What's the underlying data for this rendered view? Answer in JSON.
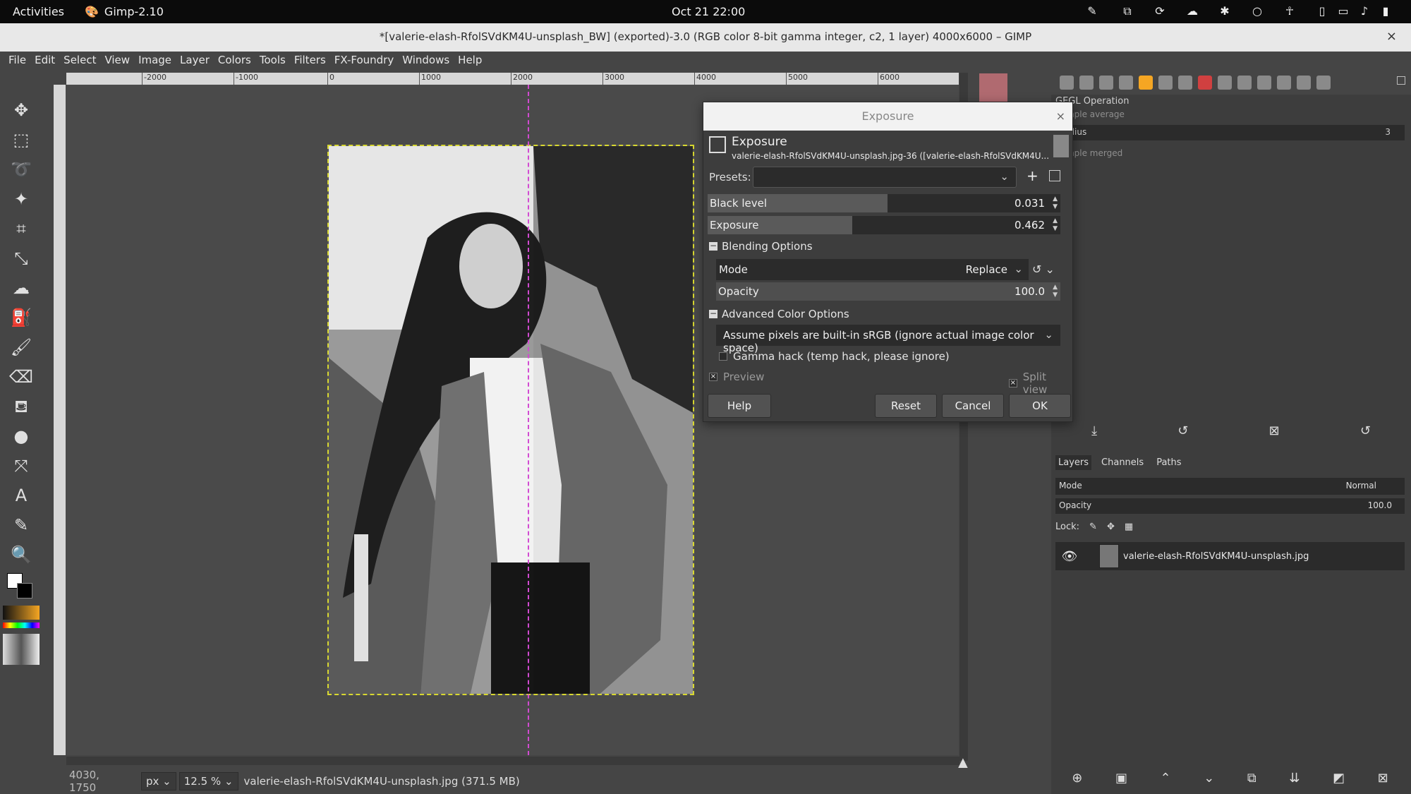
{
  "topbar": {
    "activities": "Activities",
    "app": "Gimp-2.10",
    "clock": "Oct 21  22:00"
  },
  "window": {
    "title": "*[valerie-elash-RfolSVdKM4U-unsplash_BW] (exported)-3.0 (RGB color 8-bit gamma integer, c2, 1 layer) 4000x6000 – GIMP",
    "close": "×"
  },
  "menu": [
    "File",
    "Edit",
    "Select",
    "View",
    "Image",
    "Layer",
    "Colors",
    "Tools",
    "Filters",
    "FX-Foundry",
    "Windows",
    "Help"
  ],
  "ruler_labels": [
    "-2000",
    "-1000",
    "0",
    "1000",
    "2000",
    "3000",
    "4000",
    "5000",
    "6000"
  ],
  "status": {
    "coords": "4030, 1750",
    "unit": "px",
    "zoom": "12.5 %",
    "file": "valerie-elash-RfolSVdKM4U-unsplash.jpg (371.5 MB)"
  },
  "gegl": {
    "title": "GEGL Operation",
    "sample_average": "Sample average",
    "radius_label": "Radius",
    "radius_value": "3",
    "sample_merged": "Sample merged"
  },
  "dialog": {
    "window_title": "Exposure",
    "close": "×",
    "name": "Exposure",
    "subtitle": "valerie-elash-RfolSVdKM4U-unsplash.jpg-36 ([valerie-elash-RfolSVdKM4U...",
    "presets_label": "Presets:",
    "black_level": {
      "label": "Black level",
      "value": "0.031",
      "fraction": 0.51
    },
    "exposure": {
      "label": "Exposure",
      "value": "0.462",
      "fraction": 0.41
    },
    "blending_options": "Blending Options",
    "mode_label": "Mode",
    "mode_value": "Replace",
    "opacity": {
      "label": "Opacity",
      "value": "100.0",
      "fraction": 1.0
    },
    "advanced_color_options": "Advanced Color Options",
    "color_space": "Assume pixels are built-in sRGB (ignore actual image color space)",
    "gamma_hack": "Gamma hack (temp hack, please ignore)",
    "preview": "Preview",
    "split_view": "Split view",
    "buttons": {
      "help": "Help",
      "reset": "Reset",
      "cancel": "Cancel",
      "ok": "OK"
    }
  },
  "layers": {
    "tabs": [
      "Layers",
      "Channels",
      "Paths"
    ],
    "mode_label": "Mode",
    "mode_value": "Normal",
    "opacity_label": "Opacity",
    "opacity_value": "100.0",
    "lock_label": "Lock:",
    "layer_name": "valerie-elash-RfolSVdKM4U-unsplash.jpg"
  }
}
